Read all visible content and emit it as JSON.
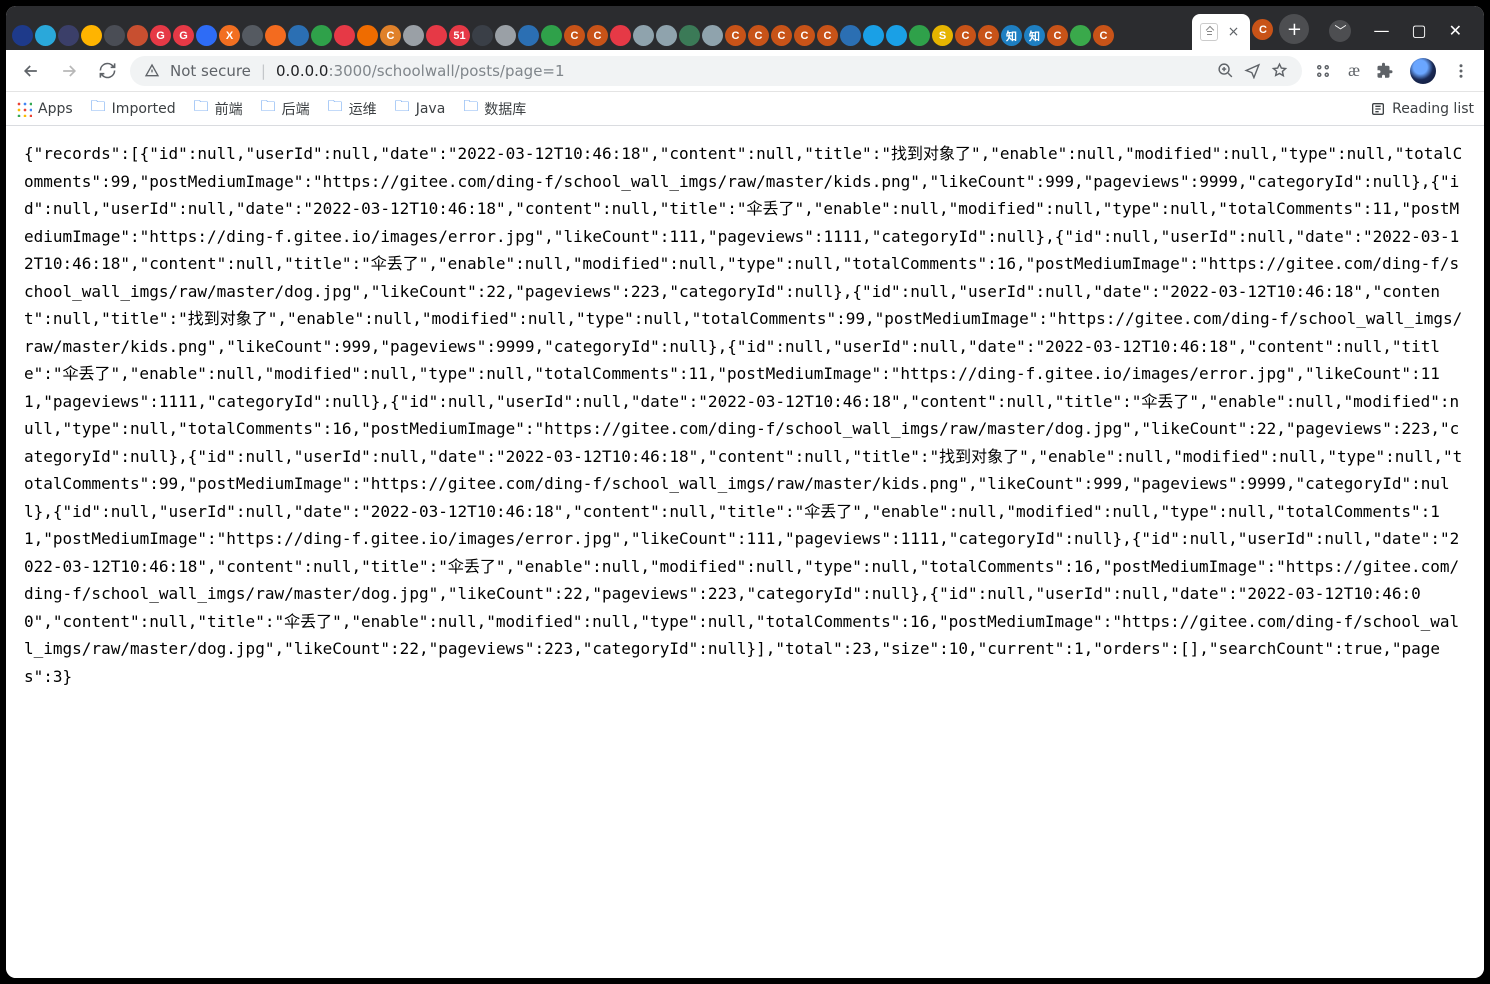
{
  "omnibox": {
    "security_label": "Not secure",
    "host": "0.0.0.0",
    "port_path": ":3000/schoolwall/posts/page=1"
  },
  "bookmarks": {
    "apps": "Apps",
    "items": [
      "Imported",
      "前端",
      "后端",
      "运维",
      "Java",
      "数据库"
    ],
    "reading_list": "Reading list"
  },
  "tab_favicon_colors": [
    "#1e3a8a",
    "#2aa8da",
    "#3b3f69",
    "#ffb400",
    "#4a4d55",
    "#c84f30",
    "#e63946",
    "#e63946",
    "#2e6cf6",
    "#f26f21",
    "#555a61",
    "#f36b1f",
    "#2b6fb3",
    "#2fa14a",
    "#e63946",
    "#ef6c00",
    "#e0812a",
    "#9aa0a6",
    "#e63946",
    "#e63946",
    "#3a3f47",
    "#9aa0a6",
    "#2b6fb3",
    "#2fa14a",
    "#c85318",
    "#c85318",
    "#e63946",
    "#8fa3ad",
    "#8fa3ad",
    "#3b7a57",
    "#8fa3ad",
    "#c85318",
    "#c85318",
    "#c85318",
    "#c85318",
    "#c85318",
    "#2b6fb3",
    "#1aa0e6",
    "#1aa0e6",
    "#2fa14a",
    "#e6b400",
    "#c85318",
    "#c85318",
    "#1e7fc2",
    "#1e7fc2",
    "#c85318",
    "#3aa94b",
    "#c85318"
  ],
  "tab_favicon_glyphs": [
    "",
    "",
    "",
    "",
    "",
    "",
    "G",
    "G",
    "",
    "X",
    "",
    "",
    "",
    "",
    "",
    "",
    "C",
    "",
    "",
    "51",
    "",
    "",
    "",
    "",
    "C",
    "C",
    "",
    "",
    "",
    "",
    "",
    "C",
    "C",
    "C",
    "C",
    "C",
    "",
    "",
    "",
    "",
    "S",
    "C",
    "C",
    "知",
    "知",
    "C",
    "",
    "C"
  ],
  "response": {
    "records": [
      {
        "id": null,
        "userId": null,
        "date": "2022-03-12T10:46:18",
        "content": null,
        "title": "找到对象了",
        "enable": null,
        "modified": null,
        "type": null,
        "totalComments": 99,
        "postMediumImage": "https://gitee.com/ding-f/school_wall_imgs/raw/master/kids.png",
        "likeCount": 999,
        "pageviews": 9999,
        "categoryId": null
      },
      {
        "id": null,
        "userId": null,
        "date": "2022-03-12T10:46:18",
        "content": null,
        "title": "伞丢了",
        "enable": null,
        "modified": null,
        "type": null,
        "totalComments": 11,
        "postMediumImage": "https://ding-f.gitee.io/images/error.jpg",
        "likeCount": 111,
        "pageviews": 1111,
        "categoryId": null
      },
      {
        "id": null,
        "userId": null,
        "date": "2022-03-12T10:46:18",
        "content": null,
        "title": "伞丢了",
        "enable": null,
        "modified": null,
        "type": null,
        "totalComments": 16,
        "postMediumImage": "https://gitee.com/ding-f/school_wall_imgs/raw/master/dog.jpg",
        "likeCount": 22,
        "pageviews": 223,
        "categoryId": null
      },
      {
        "id": null,
        "userId": null,
        "date": "2022-03-12T10:46:18",
        "content": null,
        "title": "找到对象了",
        "enable": null,
        "modified": null,
        "type": null,
        "totalComments": 99,
        "postMediumImage": "https://gitee.com/ding-f/school_wall_imgs/raw/master/kids.png",
        "likeCount": 999,
        "pageviews": 9999,
        "categoryId": null
      },
      {
        "id": null,
        "userId": null,
        "date": "2022-03-12T10:46:18",
        "content": null,
        "title": "伞丢了",
        "enable": null,
        "modified": null,
        "type": null,
        "totalComments": 11,
        "postMediumImage": "https://ding-f.gitee.io/images/error.jpg",
        "likeCount": 111,
        "pageviews": 1111,
        "categoryId": null
      },
      {
        "id": null,
        "userId": null,
        "date": "2022-03-12T10:46:18",
        "content": null,
        "title": "伞丢了",
        "enable": null,
        "modified": null,
        "type": null,
        "totalComments": 16,
        "postMediumImage": "https://gitee.com/ding-f/school_wall_imgs/raw/master/dog.jpg",
        "likeCount": 22,
        "pageviews": 223,
        "categoryId": null
      },
      {
        "id": null,
        "userId": null,
        "date": "2022-03-12T10:46:18",
        "content": null,
        "title": "找到对象了",
        "enable": null,
        "modified": null,
        "type": null,
        "totalComments": 99,
        "postMediumImage": "https://gitee.com/ding-f/school_wall_imgs/raw/master/kids.png",
        "likeCount": 999,
        "pageviews": 9999,
        "categoryId": null
      },
      {
        "id": null,
        "userId": null,
        "date": "2022-03-12T10:46:18",
        "content": null,
        "title": "伞丢了",
        "enable": null,
        "modified": null,
        "type": null,
        "totalComments": 11,
        "postMediumImage": "https://ding-f.gitee.io/images/error.jpg",
        "likeCount": 111,
        "pageviews": 1111,
        "categoryId": null
      },
      {
        "id": null,
        "userId": null,
        "date": "2022-03-12T10:46:18",
        "content": null,
        "title": "伞丢了",
        "enable": null,
        "modified": null,
        "type": null,
        "totalComments": 16,
        "postMediumImage": "https://gitee.com/ding-f/school_wall_imgs/raw/master/dog.jpg",
        "likeCount": 22,
        "pageviews": 223,
        "categoryId": null
      },
      {
        "id": null,
        "userId": null,
        "date": "2022-03-12T10:46:00",
        "content": null,
        "title": "伞丢了",
        "enable": null,
        "modified": null,
        "type": null,
        "totalComments": 16,
        "postMediumImage": "https://gitee.com/ding-f/school_wall_imgs/raw/master/dog.jpg",
        "likeCount": 22,
        "pageviews": 223,
        "categoryId": null
      }
    ],
    "total": 23,
    "size": 10,
    "current": 1,
    "orders": [],
    "searchCount": true,
    "pages": 3
  }
}
